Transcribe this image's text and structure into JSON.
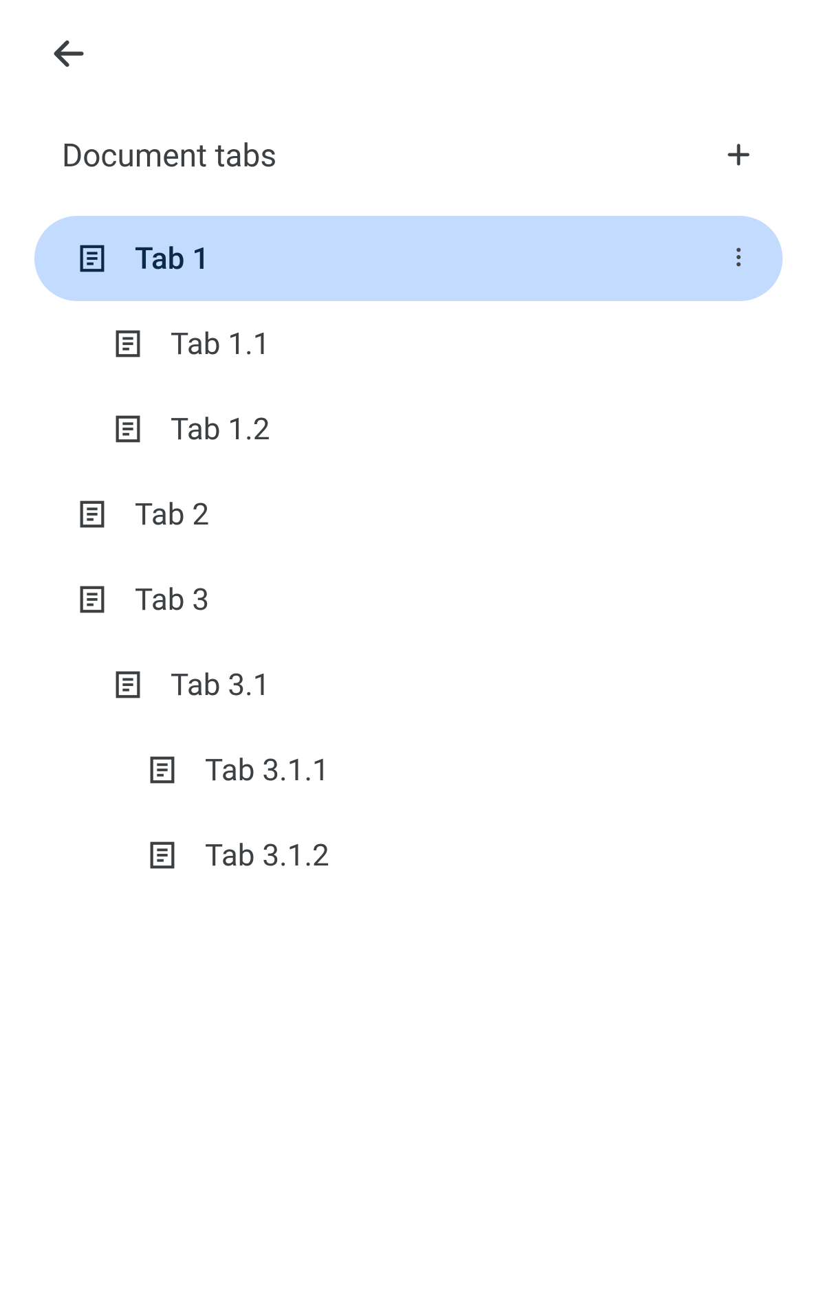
{
  "header": {
    "title": "Document tabs"
  },
  "tabs": [
    {
      "label": "Tab 1",
      "level": 0,
      "selected": true
    },
    {
      "label": "Tab 1.1",
      "level": 1,
      "selected": false
    },
    {
      "label": "Tab 1.2",
      "level": 1,
      "selected": false
    },
    {
      "label": "Tab 2",
      "level": 0,
      "selected": false
    },
    {
      "label": "Tab 3",
      "level": 0,
      "selected": false
    },
    {
      "label": "Tab 3.1",
      "level": 1,
      "selected": false
    },
    {
      "label": "Tab 3.1.1",
      "level": 2,
      "selected": false
    },
    {
      "label": "Tab 3.1.2",
      "level": 2,
      "selected": false
    }
  ]
}
